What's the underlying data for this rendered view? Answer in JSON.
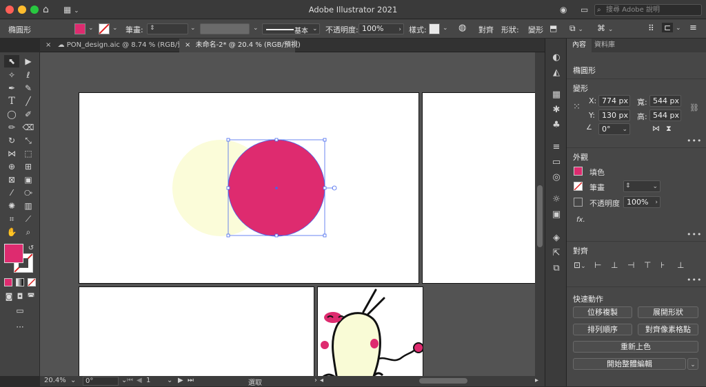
{
  "titlebar": {
    "title": "Adobe Illustrator 2021",
    "search_placeholder": "搜尋 Adobe 說明"
  },
  "control_bar": {
    "selection_type": "橢圓形",
    "stroke_label": "筆畫:",
    "brush_label": "基本",
    "opacity_label": "不透明度:",
    "opacity_value": "100%",
    "style_label": "樣式:",
    "align_label": "對齊",
    "shape_label": "形狀:",
    "transform_label": "變形",
    "fill_color": "#de2b6f"
  },
  "tabs": [
    {
      "label": "PON_design.aic @ 8.74 % (RGB/預視)",
      "active": false
    },
    {
      "label": "未命名-2* @ 20.4 % (RGB/預視)",
      "active": true
    }
  ],
  "toolbar": {
    "tools": [
      "selection-tool",
      "direct-selection-tool",
      "magic-wand-tool",
      "lasso-tool",
      "pen-tool",
      "curvature-tool",
      "type-tool",
      "line-tool",
      "ellipse-tool",
      "paintbrush-tool",
      "pencil-tool",
      "eraser-tool",
      "rotate-tool",
      "scale-tool",
      "width-tool",
      "free-transform-tool",
      "shape-builder-tool",
      "perspective-tool",
      "mesh-tool",
      "gradient-tool",
      "eyedropper-tool",
      "blend-tool",
      "symbol-sprayer-tool",
      "graph-tool",
      "artboard-tool",
      "slice-tool",
      "hand-tool",
      "zoom-tool"
    ],
    "fill_color": "#de2b6f"
  },
  "canvas": {
    "selected_fill": "#de2b6f",
    "shadow_fill": "#fbfcd9"
  },
  "status": {
    "zoom": "20.4%",
    "rotation": "0°",
    "artboard_number": "1",
    "tool_name": "選取"
  },
  "panel": {
    "tabs": [
      "內容",
      "資料庫"
    ],
    "object_type": "橢圓形",
    "transform": {
      "heading": "變形",
      "x_label": "X:",
      "x_value": "774 px",
      "y_label": "Y:",
      "y_value": "130 px",
      "w_label": "寬:",
      "w_value": "544 px",
      "h_label": "高:",
      "h_value": "544 px",
      "angle_value": "0°"
    },
    "appearance": {
      "heading": "外觀",
      "fill_label": "填色",
      "stroke_label": "筆畫",
      "opacity_label": "不透明度",
      "opacity_value": "100%"
    },
    "align": {
      "heading": "對齊"
    },
    "quick_actions": {
      "heading": "快速動作",
      "buttons": [
        "位移複製",
        "展開形狀",
        "排列順序",
        "對齊像素格點",
        "重新上色",
        "開始整體編輯"
      ]
    }
  }
}
